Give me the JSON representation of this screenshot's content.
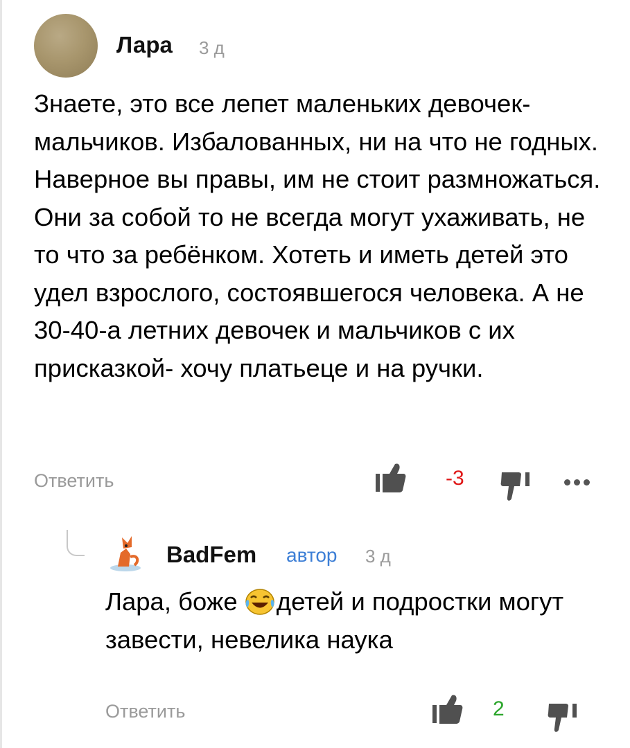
{
  "comments": [
    {
      "author": "Лара",
      "time": "3 д",
      "body": "Знаете, это все лепет маленьких девочек-мальчиков. Избалованных, ни на что не годных. Наверное вы правы, им не стоит размножаться. Они за собой то не всегда могут ухаживать, не то что за ребёнком. Хотеть и иметь детей это удел взрослого, состоявшегося человека. А не 30-40-а летних девочек и мальчиков с их присказкой- хочу платьеце и на ручки.",
      "reply_label": "Ответить",
      "score": "-3",
      "score_color": "#e01818"
    },
    {
      "author": "BadFem",
      "badge": "автор",
      "badge_color": "#3d7fd6",
      "time": "3 д",
      "body_before_emoji": "Лара, боже ",
      "emoji": "face-with-tears-of-joy",
      "body_after_emoji": "детей и подростки могут завести, невелика наука",
      "reply_label": "Ответить",
      "score": "2",
      "score_color": "#2aa52a"
    }
  ],
  "icons": {
    "like": "thumb-up-icon",
    "dislike": "thumb-down-icon",
    "more": "more-dots-icon"
  }
}
